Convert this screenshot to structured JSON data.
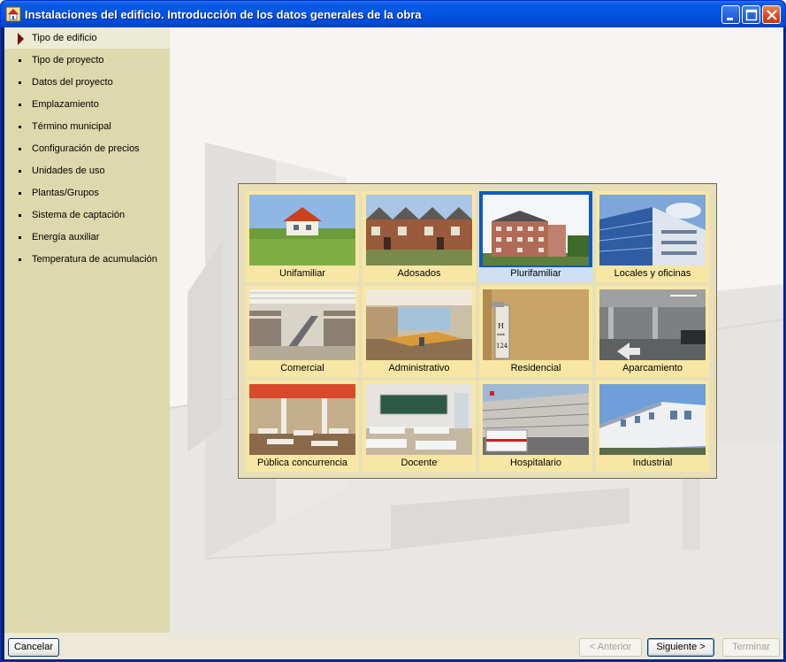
{
  "window": {
    "title": "Instalaciones del edificio. Introducción de los datos generales de la obra",
    "colors": {
      "titlebar": "#0054e3",
      "sidebar": "#ded9ad",
      "panel": "#e8dfb8",
      "tile": "#f8e7a4",
      "selected": "#0c5ac8"
    }
  },
  "sidebar": {
    "items": [
      {
        "label": "Tipo de edificio",
        "active": true
      },
      {
        "label": "Tipo de proyecto"
      },
      {
        "label": "Datos del proyecto"
      },
      {
        "label": "Emplazamiento"
      },
      {
        "label": "Término municipal"
      },
      {
        "label": "Configuración de precios"
      },
      {
        "label": "Unidades de uso"
      },
      {
        "label": "Plantas/Grupos"
      },
      {
        "label": "Sistema de captación"
      },
      {
        "label": "Energía auxiliar"
      },
      {
        "label": "Temperatura de acumulación"
      }
    ]
  },
  "building_types": [
    {
      "label": "Unifamiliar",
      "icon": "house-photo"
    },
    {
      "label": "Adosados",
      "icon": "terraced-houses-photo"
    },
    {
      "label": "Plurifamiliar",
      "icon": "apartment-block-photo",
      "selected": true
    },
    {
      "label": "Locales y oficinas",
      "icon": "office-building-photo"
    },
    {
      "label": "Comercial",
      "icon": "shopping-mall-photo"
    },
    {
      "label": "Administrativo",
      "icon": "office-interior-photo"
    },
    {
      "label": "Residencial",
      "icon": "hotel-door-photo"
    },
    {
      "label": "Aparcamiento",
      "icon": "parking-garage-photo"
    },
    {
      "label": "Pública concurrencia",
      "icon": "restaurant-photo"
    },
    {
      "label": "Docente",
      "icon": "classroom-photo"
    },
    {
      "label": "Hospitalario",
      "icon": "hospital-photo"
    },
    {
      "label": "Industrial",
      "icon": "industrial-building-photo"
    }
  ],
  "footer": {
    "cancel_label": "Cancelar",
    "prev_label": "< Anterior",
    "next_label": "Siguiente >",
    "finish_label": "Terminar"
  }
}
